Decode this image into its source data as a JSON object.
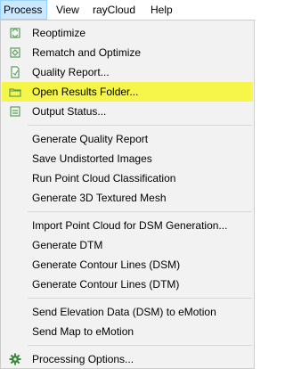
{
  "menubar": {
    "items": [
      {
        "label": "Process",
        "active": true
      },
      {
        "label": "View"
      },
      {
        "label": "rayCloud"
      },
      {
        "label": "Help"
      }
    ]
  },
  "menu": {
    "highlight_color": "#f5f54a",
    "items": [
      {
        "label": "Reoptimize",
        "icon": "reoptimize-icon"
      },
      {
        "label": "Rematch and Optimize",
        "icon": "rematch-icon"
      },
      {
        "label": "Quality Report...",
        "icon": "quality-report-icon"
      },
      {
        "label": "Open Results Folder...",
        "icon": "folder-icon",
        "highlighted": true
      },
      {
        "label": "Output Status...",
        "icon": "output-status-icon"
      },
      {
        "label": "Generate Quality Report"
      },
      {
        "label": "Save Undistorted Images"
      },
      {
        "label": "Run Point Cloud Classification"
      },
      {
        "label": "Generate 3D Textured Mesh"
      },
      {
        "label": "Import Point Cloud for DSM Generation..."
      },
      {
        "label": "Generate DTM"
      },
      {
        "label": "Generate Contour Lines (DSM)"
      },
      {
        "label": "Generate Contour Lines (DTM)"
      },
      {
        "label": "Send Elevation Data (DSM) to eMotion"
      },
      {
        "label": "Send Map to eMotion"
      },
      {
        "label": "Processing Options...",
        "icon": "gear-icon"
      }
    ]
  }
}
